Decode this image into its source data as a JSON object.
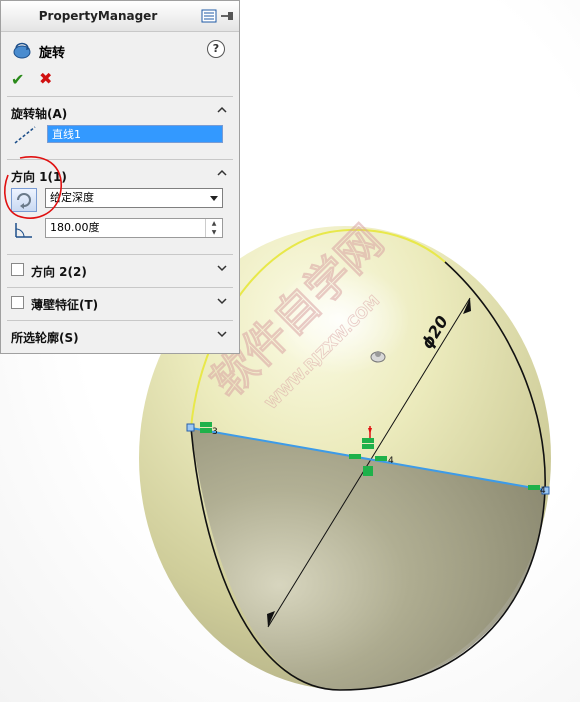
{
  "panel": {
    "title": "PropertyManager",
    "feature_name": "旋转",
    "help_glyph": "?",
    "ok_glyph": "✔",
    "cancel_glyph": "✖",
    "axis_section": {
      "title": "旋转轴(A)",
      "value": "直线1"
    },
    "direction1": {
      "title": "方向 1(1)",
      "end_condition": "给定深度",
      "angle": "180.00度"
    },
    "direction2": {
      "title": "方向 2(2)"
    },
    "thin_feature": {
      "title": "薄壁特征(T)"
    },
    "selected_contours": {
      "title": "所选轮廓(S)"
    }
  },
  "drawing": {
    "dimension_text": "ϕ20",
    "vertex_labels": [
      "3",
      "4",
      "4"
    ],
    "watermark_cn": "软件自学网",
    "watermark_en": "WWW.RJZXW.COM"
  },
  "colors": {
    "sphere_light": "#f7f6cf",
    "sphere_dark": "#8f8c73",
    "centerline": "#3d9be8",
    "relation_green": "#1fb14a",
    "annotation_red": "#e01010"
  }
}
